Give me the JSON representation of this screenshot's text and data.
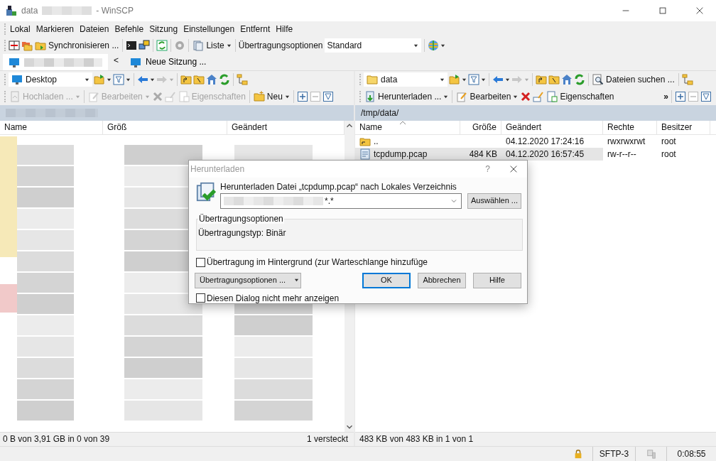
{
  "window": {
    "title": "data",
    "title_suffix": "- WinSCP"
  },
  "menu": [
    "Lokal",
    "Markieren",
    "Dateien",
    "Befehle",
    "Sitzung",
    "Einstellungen",
    "Entfernt",
    "Hilfe"
  ],
  "toolbar": {
    "sync_label": "Synchronisieren ...",
    "view_label": "Liste",
    "transfer_label": "Übertragungsoptionen",
    "transfer_preset": "Standard"
  },
  "session_tabs": [
    {
      "kind": "blurred",
      "selected": true
    },
    {
      "kind": "new",
      "label": "Neue Sitzung ...",
      "selected": false
    }
  ],
  "tab_scroll": "<",
  "left_panel": {
    "location": "Desktop",
    "buttons": [
      {
        "label": "Hochladen ...",
        "disabled": true
      },
      {
        "label": "Bearbeiten",
        "disabled": true
      },
      {
        "label": "Eigenschaften",
        "disabled": true
      },
      {
        "label": "Neu",
        "disabled": false
      }
    ],
    "columns": [
      "Name",
      "Größ",
      "Geändert"
    ],
    "status": "0 B von 3,91 GB in 0 von 39",
    "hidden_note": "1 versteckt"
  },
  "right_panel": {
    "location": "data",
    "find_label": "Dateien suchen ...",
    "buttons": [
      {
        "label": "Herunterladen ...",
        "disabled": false
      },
      {
        "label": "Bearbeiten",
        "disabled": false
      },
      {
        "label": "Eigenschaften",
        "disabled": false
      }
    ],
    "overflow": "»",
    "path": "/tmp/data/",
    "columns": [
      "Name",
      "Größe",
      "Geändert",
      "Rechte",
      "Besitzer"
    ],
    "rows": [
      {
        "kind": "parent",
        "name": "..",
        "modified": "04.12.2020 17:24:16",
        "rights": "rwxrwxrwt",
        "owner": "root",
        "selected": false
      },
      {
        "kind": "file",
        "name": "tcpdump.pcap",
        "size": "484 KB",
        "modified": "04.12.2020 16:57:45",
        "rights": "rw-r--r--",
        "owner": "root",
        "selected": true
      }
    ],
    "status": "483 KB von 483 KB in 1 von 1"
  },
  "status_bar": {
    "protocol": "SFTP-3",
    "elapsed": "0:08:55"
  },
  "dialog": {
    "title": "Herunterladen",
    "help": "?",
    "message": "Herunterladen Datei „tcpdump.pcap“ nach Lokales Verzeichnis",
    "target_suffix": "*.*",
    "browse_label": "Auswählen ...",
    "group_title": "Übertragungsoptionen",
    "group_text": "Übertragungstyp: Binär",
    "options": [
      {
        "label": "Übertragung im Hintergrund (zur Warteschlange hinzufüge",
        "checked": false
      }
    ],
    "options_button": "Übertragungsoptionen ...",
    "buttons": [
      {
        "label": "OK",
        "default": true
      },
      {
        "label": "Abbrechen",
        "default": false
      },
      {
        "label": "Hilfe",
        "default": false
      }
    ],
    "footer_option": {
      "label": "Diesen Dialog nicht mehr anzeigen",
      "checked": false
    }
  }
}
